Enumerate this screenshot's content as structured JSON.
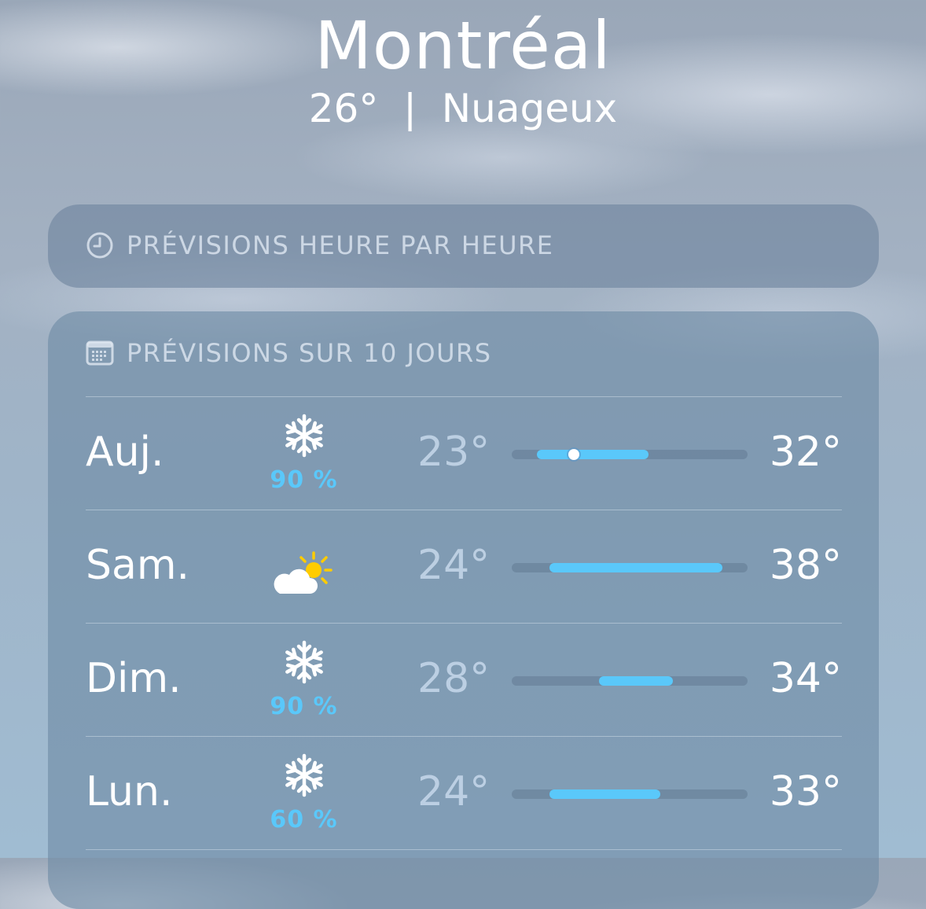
{
  "header": {
    "city": "Montréal",
    "current": "26°  |  Nuageux"
  },
  "hourly_card": {
    "title": "PRÉVISIONS HEURE PAR HEURE",
    "icon": "clock-icon"
  },
  "daily_card": {
    "title": "PRÉVISIONS SUR 10 JOURS",
    "icon": "calendar-icon",
    "range_min": 23,
    "range_max": 38,
    "accent": "#5ac8fa",
    "days": [
      {
        "day": "Auj.",
        "icon": "snowflake-icon",
        "precip": "90 %",
        "low": "23°",
        "high": "32°",
        "low_value": 23,
        "high_value": 32,
        "current_value": 26
      },
      {
        "day": "Sam.",
        "icon": "partly-sunny-icon",
        "precip": "",
        "low": "24°",
        "high": "38°",
        "low_value": 24,
        "high_value": 38
      },
      {
        "day": "Dim.",
        "icon": "snowflake-icon",
        "precip": "90 %",
        "low": "28°",
        "high": "34°",
        "low_value": 28,
        "high_value": 34
      },
      {
        "day": "Lun.",
        "icon": "snowflake-icon",
        "precip": "60 %",
        "low": "24°",
        "high": "33°",
        "low_value": 24,
        "high_value": 33
      }
    ]
  }
}
